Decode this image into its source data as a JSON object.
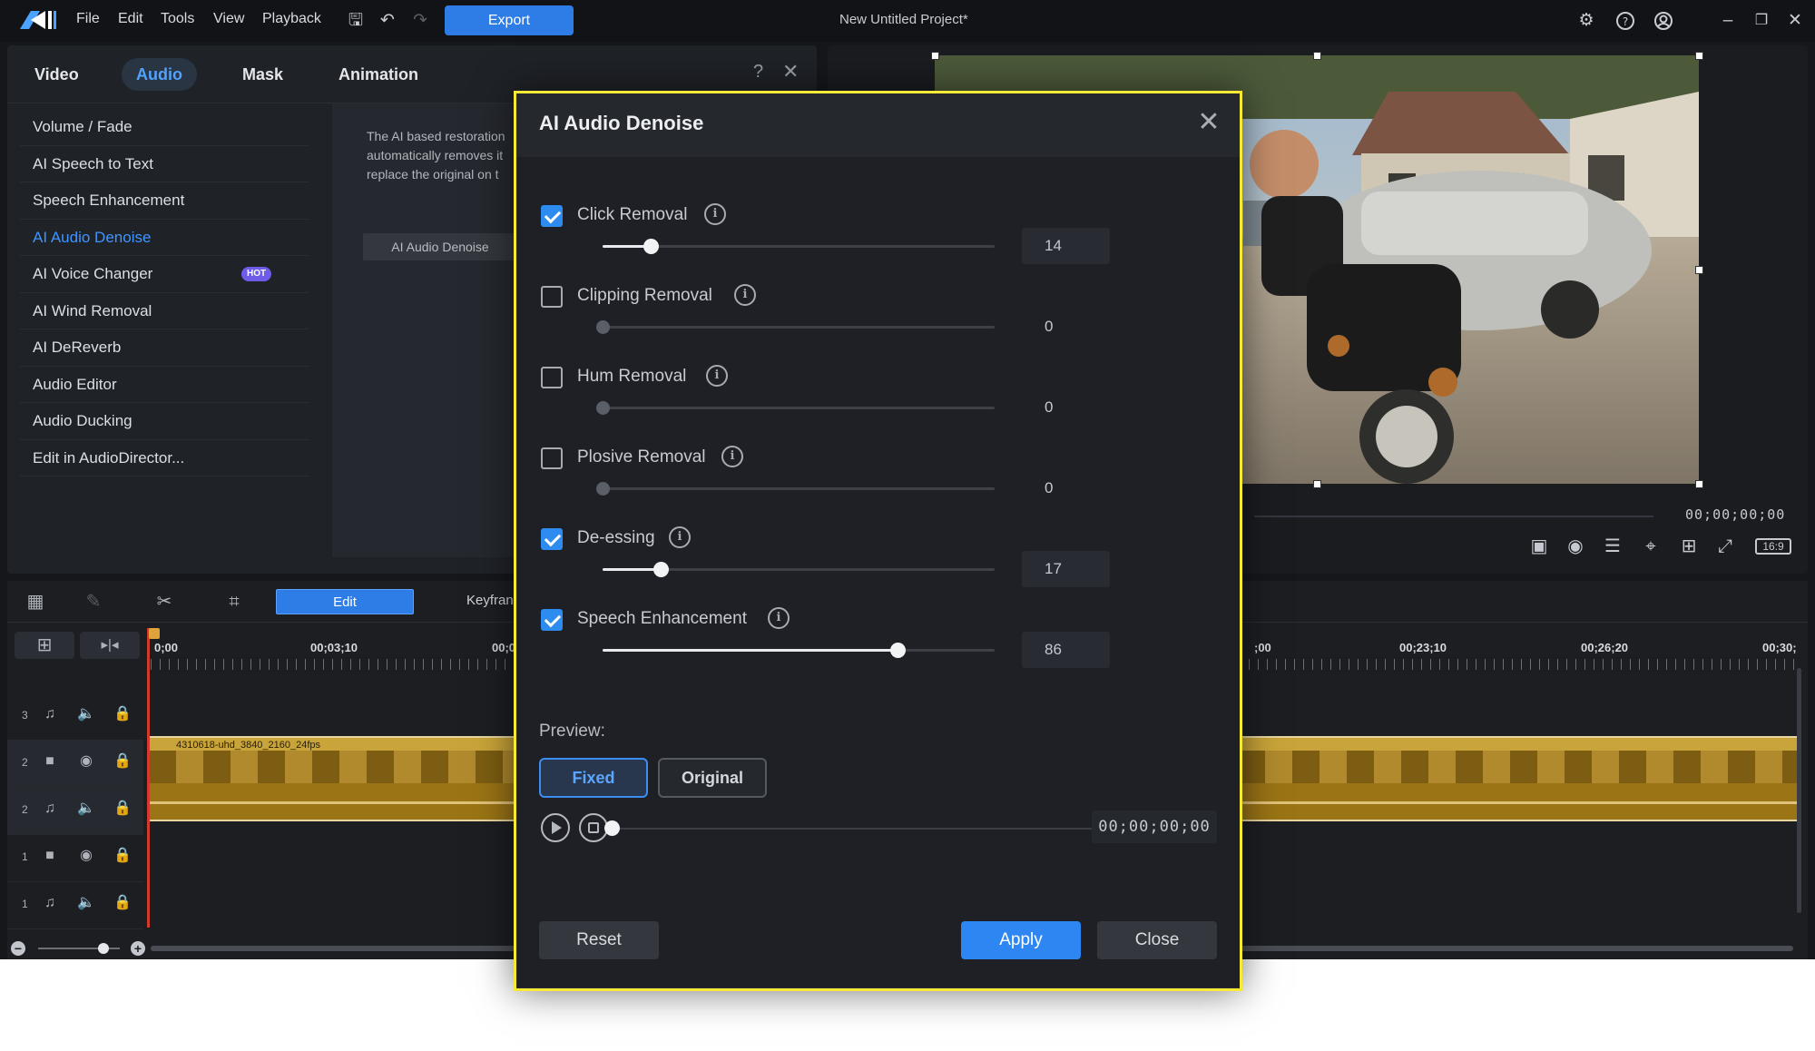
{
  "titlebar": {
    "menus": [
      "File",
      "Edit",
      "Tools",
      "View",
      "Playback"
    ],
    "export_label": "Export",
    "project_title": "New Untitled Project*"
  },
  "panel": {
    "tabs": [
      {
        "label": "Video"
      },
      {
        "label": "Audio"
      },
      {
        "label": "Mask"
      },
      {
        "label": "Animation"
      }
    ],
    "active_tab": "Audio",
    "help": "?",
    "features": [
      {
        "label": "Volume / Fade"
      },
      {
        "label": "AI Speech to Text"
      },
      {
        "label": "Speech Enhancement"
      },
      {
        "label": "AI Audio Denoise"
      },
      {
        "label": "AI Voice Changer",
        "badge": "HOT"
      },
      {
        "label": "AI Wind Removal"
      },
      {
        "label": "AI DeReverb"
      },
      {
        "label": "Audio Editor"
      },
      {
        "label": "Audio Ducking"
      },
      {
        "label": "Edit in AudioDirector..."
      }
    ],
    "active_feature": "AI Audio Denoise",
    "description_lines": [
      "The AI based restoration",
      "automatically removes it",
      "replace the original on t"
    ],
    "description_button": "AI Audio Denoise"
  },
  "preview": {
    "timecode": "00;00;00;00",
    "aspect": "16:9"
  },
  "timeline": {
    "edit_label": "Edit",
    "keyframe_label": "Keyfran",
    "ruler_labels": [
      {
        "text": "0;00"
      },
      {
        "text": "00;03;10"
      },
      {
        "text": "00;0"
      },
      {
        "text": ";00"
      },
      {
        "text": "00;23;10"
      },
      {
        "text": "00;26;20"
      },
      {
        "text": "00;30;"
      }
    ],
    "tracks": [
      {
        "num": "3",
        "kind": "audio"
      },
      {
        "num": "2",
        "kind": "video"
      },
      {
        "num": "2",
        "kind": "audio"
      },
      {
        "num": "1",
        "kind": "video"
      },
      {
        "num": "1",
        "kind": "audio"
      }
    ],
    "clip_name": "4310618-uhd_3840_2160_24fps"
  },
  "dialog": {
    "title": "AI Audio Denoise",
    "options": [
      {
        "label": "Click Removal",
        "checked": true,
        "value": 14
      },
      {
        "label": "Clipping Removal",
        "checked": false,
        "value": 0
      },
      {
        "label": "Hum Removal",
        "checked": false,
        "value": 0
      },
      {
        "label": "Plosive Removal",
        "checked": false,
        "value": 0
      },
      {
        "label": "De-essing",
        "checked": true,
        "value": 17
      },
      {
        "label": "Speech Enhancement",
        "checked": true,
        "value": 86
      }
    ],
    "preview_label": "Preview:",
    "fixed_label": "Fixed",
    "original_label": "Original",
    "preview_time": "00;00;00;00",
    "reset_label": "Reset",
    "apply_label": "Apply",
    "close_label": "Close"
  },
  "colors": {
    "accent": "#2e86f2",
    "highlight_border": "#f7ea37",
    "clip": "#9a7415"
  }
}
